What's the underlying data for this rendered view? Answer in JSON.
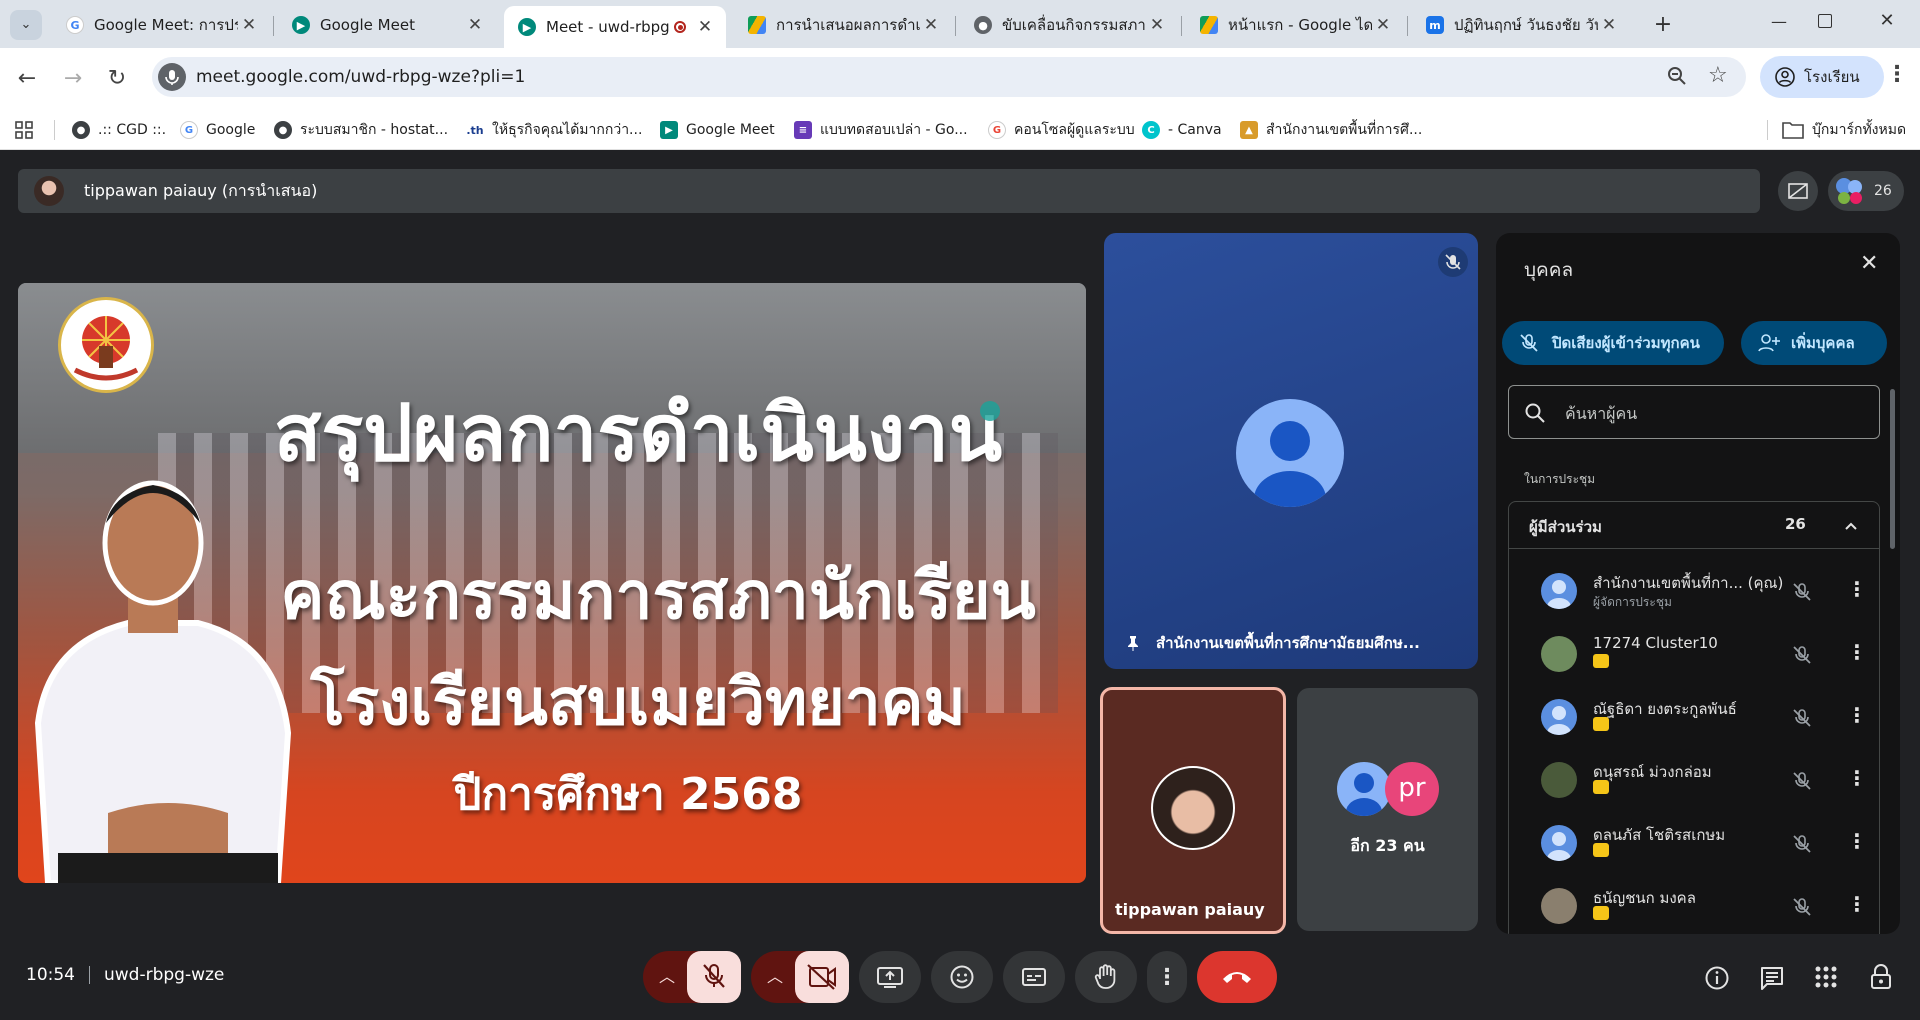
{
  "browser": {
    "tabs": [
      {
        "title": "Google Meet: การประ",
        "favicon": "google-g-icon"
      },
      {
        "title": "Google Meet",
        "favicon": "meet-icon"
      },
      {
        "title": "Meet - uwd-rbpg",
        "favicon": "meet-icon",
        "recording": true
      },
      {
        "title": "การนำเสนอผลการดำเนิ",
        "favicon": "drive-icon"
      },
      {
        "title": "ขับเคลื่อนกิจกรรมสภานั",
        "favicon": "globe-icon"
      },
      {
        "title": "หน้าแรก - Google ไดรฟ์",
        "favicon": "drive-icon"
      },
      {
        "title": "ปฏิทินฤกษ์ วันธงชัย วันเ",
        "favicon": "m-icon"
      }
    ],
    "url": "meet.google.com/uwd-rbpg-wze?pli=1",
    "profile_label": "โรงเรียน",
    "bookmarks": [
      ".:: CGD ::.",
      "Google",
      "ระบบสมาชิก - hostat...",
      "ให้ธุรกิจคุณได้มากกว่า...",
      "Google Meet",
      "แบบทดสอบเปล่า - Go...",
      "คอนโซลผู้ดูแลระบบ",
      "- Canva",
      "สำนักงานเขตพื้นที่การศึ..."
    ],
    "all_bookmarks_label": "บุ๊กมาร์กทั้งหมด"
  },
  "meet": {
    "presenter_label": "tippawan paiauy (การนำเสนอ)",
    "participant_count": "26",
    "slide": {
      "line1": "สรุปผลการดำเนินงาน",
      "line2": "คณะกรรมการสภานักเรียน",
      "line3": "โรงเรียนสบเมยวิทยาคม",
      "line4": "ปีการศึกษา 2568"
    },
    "tiles": {
      "org_name": "สำนักงานเขตพื้นที่การศึกษามัธยมศึกษ...",
      "tippawan_name": "tippawan paiauy",
      "more_initials": "pr",
      "more_label": "อีก 23 คน"
    },
    "people_panel": {
      "title": "บุคคล",
      "mute_all_label": "ปิดเสียงผู้เข้าร่วมทุกคน",
      "add_people_label": "เพิ่มบุคคล",
      "search_placeholder": "ค้นหาผู้คน",
      "section_label": "ในการประชุม",
      "group_label": "ผู้มีส่วนร่วม",
      "group_count": "26",
      "participants": [
        {
          "name": "สำนักงานเขตพื้นที่กา...  (คุณ)",
          "sub": "ผู้จัดการประชุม"
        },
        {
          "name": "17274 Cluster10",
          "sub": ""
        },
        {
          "name": "ณัฐธิดา ยงตระกูลพันธ์",
          "sub": ""
        },
        {
          "name": "ดนุสรณ์ ม่วงกล่อม",
          "sub": ""
        },
        {
          "name": "ดลนภัส โชติรสเกษม",
          "sub": ""
        },
        {
          "name": "ธนัญชนก มงคล",
          "sub": ""
        }
      ]
    },
    "bottom": {
      "time": "10:54",
      "meeting_code": "uwd-rbpg-wze"
    }
  },
  "colors": {
    "hangup": "#dc362e",
    "muted_bg": "#f9dedc",
    "muted_side": "#601410",
    "accent_blue": "#004a77"
  }
}
